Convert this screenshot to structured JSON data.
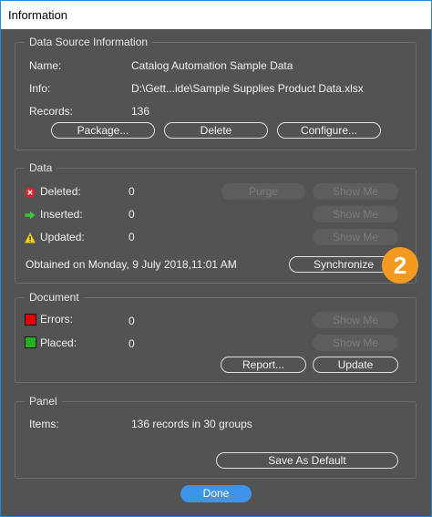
{
  "window": {
    "title": "Information"
  },
  "data_source": {
    "legend": "Data Source Information",
    "name_label": "Name:",
    "name_value": "Catalog Automation Sample Data",
    "info_label": "Info:",
    "info_value": "D:\\Gett...ide\\Sample Supplies Product Data.xlsx",
    "records_label": "Records:",
    "records_value": "136",
    "package_button": "Package...",
    "delete_button": "Delete",
    "configure_button": "Configure..."
  },
  "data": {
    "legend": "Data",
    "deleted_label": "Deleted:",
    "deleted_value": "0",
    "inserted_label": "Inserted:",
    "inserted_value": "0",
    "updated_label": "Updated:",
    "updated_value": "0",
    "purge_button": "Purge",
    "show_me_button": "Show Me",
    "obtained_text": "Obtained on Monday, 9 July 2018,11:01 AM",
    "synchronize_button": "Synchronize",
    "callout_number": "2"
  },
  "document": {
    "legend": "Document",
    "errors_label": "Errors:",
    "errors_value": "0",
    "placed_label": "Placed:",
    "placed_value": "0",
    "show_me_button": "Show Me",
    "report_button": "Report...",
    "update_button": "Update"
  },
  "panel": {
    "legend": "Panel",
    "items_label": "Items:",
    "items_value": "136 records in 30 groups",
    "save_default_button": "Save As Default"
  },
  "footer": {
    "done_button": "Done"
  },
  "colors": {
    "accent": "#3d94e8",
    "callout": "#f49a20",
    "error_swatch": "#e00000",
    "placed_swatch": "#22b022"
  }
}
